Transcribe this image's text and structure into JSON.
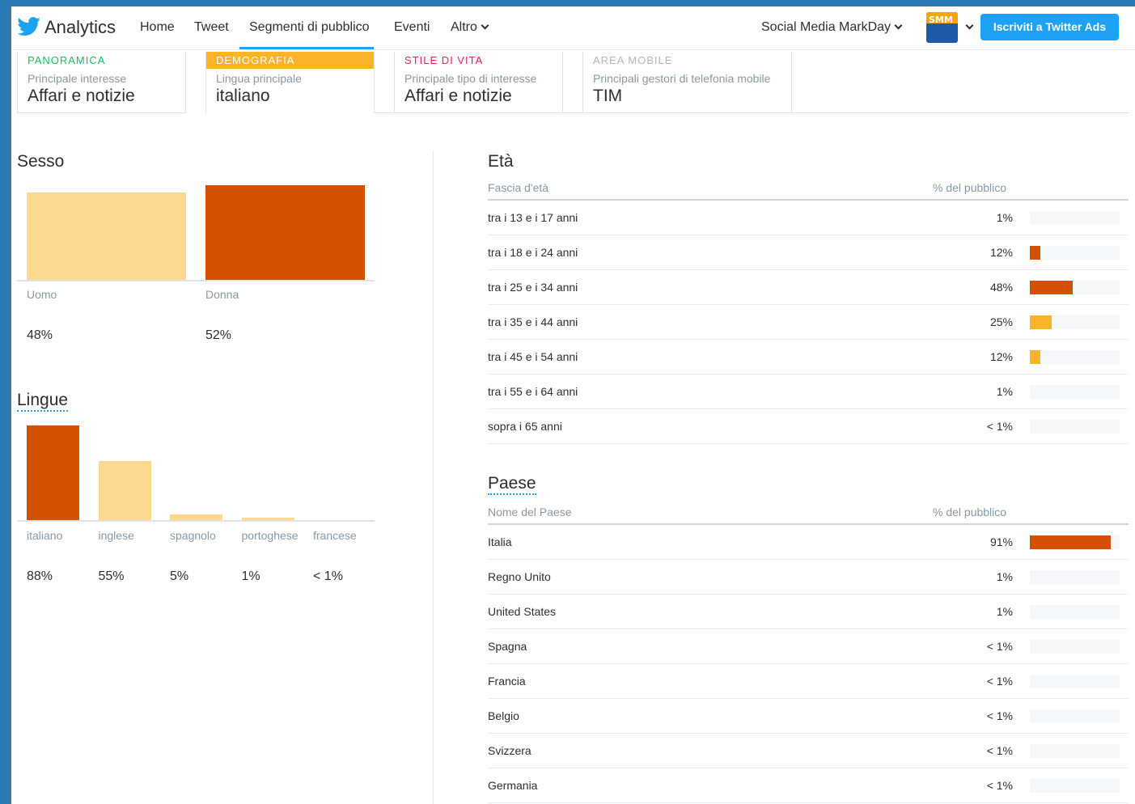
{
  "nav": {
    "brand": "Analytics",
    "links": [
      "Home",
      "Tweet",
      "Segmenti di pubblico",
      "Eventi",
      "Altro"
    ],
    "account": "Social Media MarkDay",
    "avatar_text": "SMM",
    "ads_button": "Iscriviti a Twitter Ads"
  },
  "cards": [
    {
      "tab": "PANORAMICA",
      "subtitle": "Principale interesse",
      "value": "Affari e notizie",
      "tab_color": "#17bf63"
    },
    {
      "tab": "DEMOGRAFIA",
      "subtitle": "Lingua principale",
      "value": "italiano",
      "tab_color": "#ffffff",
      "tab_bg": "#fbb42a"
    },
    {
      "tab": "STILE DI VITA",
      "subtitle": "Principale tipo di interesse",
      "value": "Affari e notizie",
      "tab_color": "#e0245e"
    },
    {
      "tab": "AREA MOBILE",
      "subtitle": "Principali gestori di telefonia mobile",
      "value": "TIM",
      "tab_color": "#aab8c2"
    }
  ],
  "gender": {
    "title": "Sesso",
    "items": [
      {
        "label": "Uomo",
        "pct_text": "48%",
        "value": 48,
        "color": "#fcd98f"
      },
      {
        "label": "Donna",
        "pct_text": "52%",
        "value": 52,
        "color": "#d54f00"
      }
    ]
  },
  "languages": {
    "title": "Lingue",
    "items": [
      {
        "label": "italiano",
        "pct_text": "88%",
        "value": 88,
        "color": "#d54f00"
      },
      {
        "label": "inglese",
        "pct_text": "55%",
        "value": 55,
        "color": "#fcd98f"
      },
      {
        "label": "spagnolo",
        "pct_text": "5%",
        "value": 5,
        "color": "#fcd98f"
      },
      {
        "label": "portoghese",
        "pct_text": "1%",
        "value": 1,
        "color": "#fcd98f"
      },
      {
        "label": "francese",
        "pct_text": "< 1%",
        "value": 0,
        "color": "#fcd98f"
      }
    ]
  },
  "age": {
    "title": "Età",
    "col1": "Fascia d'età",
    "col2": "% del pubblico",
    "rows": [
      {
        "label": "tra i 13 e i 17 anni",
        "pct_text": "1%",
        "value": 1,
        "color": "#f5f8fa"
      },
      {
        "label": "tra i 18 e i 24 anni",
        "pct_text": "12%",
        "value": 12,
        "color": "#d54f00"
      },
      {
        "label": "tra i 25 e i 34 anni",
        "pct_text": "48%",
        "value": 48,
        "color": "#d54f00"
      },
      {
        "label": "tra i 35 e i 44 anni",
        "pct_text": "25%",
        "value": 25,
        "color": "#fbb42a"
      },
      {
        "label": "tra i 45 e i 54 anni",
        "pct_text": "12%",
        "value": 12,
        "color": "#fbb42a"
      },
      {
        "label": "tra i 55 e i 64 anni",
        "pct_text": "1%",
        "value": 1,
        "color": "#f5f8fa"
      },
      {
        "label": "sopra i 65 anni",
        "pct_text": "< 1%",
        "value": 0,
        "color": "#f5f8fa"
      }
    ]
  },
  "country": {
    "title": "Paese",
    "col1": "Nome del Paese",
    "col2": "% del pubblico",
    "rows": [
      {
        "label": "Italia",
        "pct_text": "91%",
        "value": 91,
        "color": "#d54f00"
      },
      {
        "label": "Regno Unito",
        "pct_text": "1%",
        "value": 1,
        "color": "#f5f8fa"
      },
      {
        "label": "United States",
        "pct_text": "1%",
        "value": 1,
        "color": "#f5f8fa"
      },
      {
        "label": "Spagna",
        "pct_text": "< 1%",
        "value": 0,
        "color": "#f5f8fa"
      },
      {
        "label": "Francia",
        "pct_text": "< 1%",
        "value": 0,
        "color": "#f5f8fa"
      },
      {
        "label": "Belgio",
        "pct_text": "< 1%",
        "value": 0,
        "color": "#f5f8fa"
      },
      {
        "label": "Svizzera",
        "pct_text": "< 1%",
        "value": 0,
        "color": "#f5f8fa"
      },
      {
        "label": "Germania",
        "pct_text": "< 1%",
        "value": 0,
        "color": "#f5f8fa"
      }
    ]
  }
}
